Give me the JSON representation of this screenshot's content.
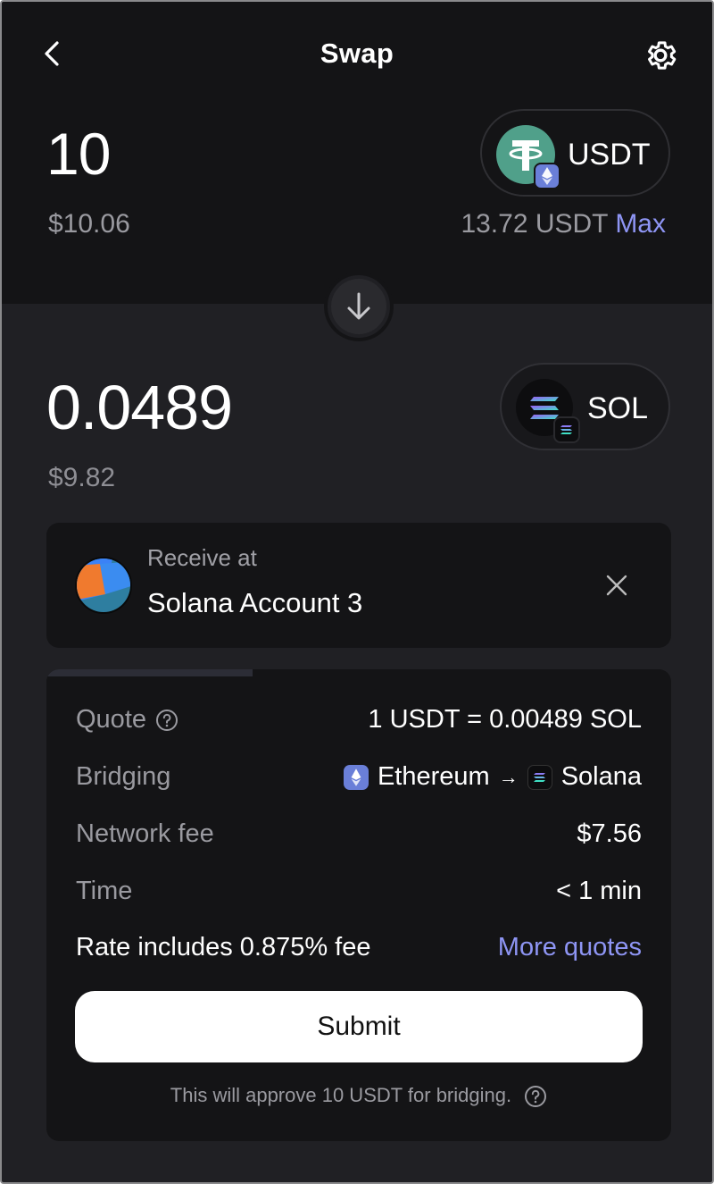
{
  "header": {
    "title": "Swap",
    "back_icon": "chevron-left-icon",
    "settings_icon": "gear-icon"
  },
  "from": {
    "amount": "10",
    "usd_value": "$10.06",
    "token": "USDT",
    "token_icon": "tether-icon",
    "network_badge": "ethereum-icon",
    "balance": "13.72 USDT",
    "max_label": "Max"
  },
  "swap_direction_icon": "arrow-down-icon",
  "to": {
    "amount": "0.0489",
    "usd_value": "$9.82",
    "token": "SOL",
    "token_icon": "solana-icon",
    "network_badge": "solana-icon"
  },
  "receive": {
    "label": "Receive at",
    "account": "Solana Account 3",
    "close_icon": "close-icon"
  },
  "quote": {
    "refresh_progress": 0.33,
    "rows": [
      {
        "key": "Quote",
        "value": "1 USDT = 0.00489 SOL"
      },
      {
        "key": "Bridging",
        "from_chain": "Ethereum",
        "arrow": "→",
        "to_chain": "Solana"
      },
      {
        "key": "Network fee",
        "value": "$7.56"
      },
      {
        "key": "Time",
        "value": "< 1 min"
      }
    ],
    "fee_note": "Rate includes 0.875% fee",
    "more_quotes": "More quotes",
    "submit": "Submit",
    "approve_note": "This will approve 10 USDT for bridging."
  },
  "colors": {
    "accent": "#8e95f4",
    "background_top": "#141416",
    "background_main": "#202024",
    "card": "#141416",
    "usdt": "#50a08a",
    "ethereum": "#6a7fd8"
  }
}
